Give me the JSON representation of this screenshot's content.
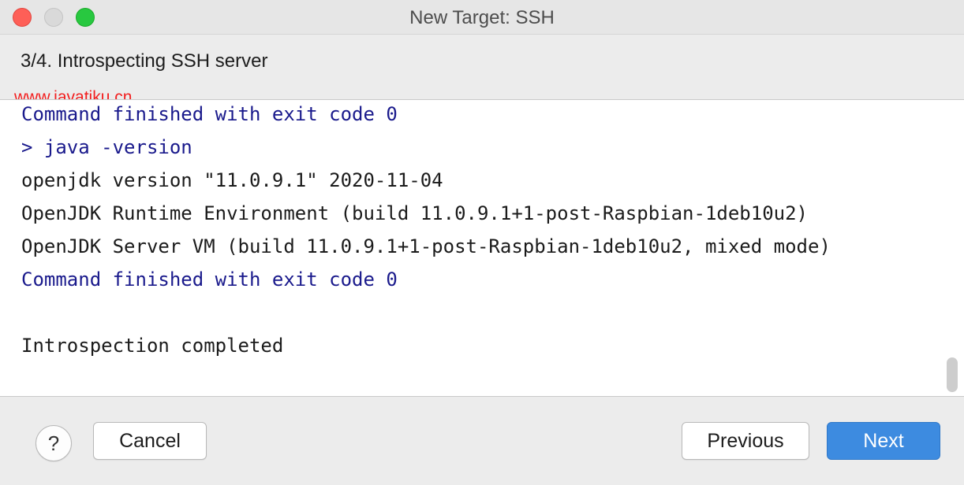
{
  "window": {
    "title": "New Target: SSH"
  },
  "header": {
    "step_title": "3/4. Introspecting SSH server",
    "watermark": "www.javatiku.cn"
  },
  "console": {
    "lines": [
      {
        "text": "Command finished with exit code 0",
        "color": "#1a1a8c"
      },
      {
        "text": "> java -version",
        "color": "#1a1a8c"
      },
      {
        "text": "openjdk version \"11.0.9.1\" 2020-11-04",
        "color": "#1b1b1b"
      },
      {
        "text": "OpenJDK Runtime Environment (build 11.0.9.1+1-post-Raspbian-1deb10u2)",
        "color": "#1b1b1b"
      },
      {
        "text": "OpenJDK Server VM (build 11.0.9.1+1-post-Raspbian-1deb10u2, mixed mode)",
        "color": "#1b1b1b"
      },
      {
        "text": "Command finished with exit code 0",
        "color": "#1a1a8c"
      },
      {
        "text": "",
        "color": "#1b1b1b"
      },
      {
        "text": "Introspection completed",
        "color": "#1b1b1b"
      }
    ]
  },
  "footer": {
    "help_label": "?",
    "cancel_label": "Cancel",
    "previous_label": "Previous",
    "next_label": "Next"
  },
  "colors": {
    "accent": "#3d8be0",
    "close": "#fe5f57",
    "maximize": "#28c840"
  }
}
